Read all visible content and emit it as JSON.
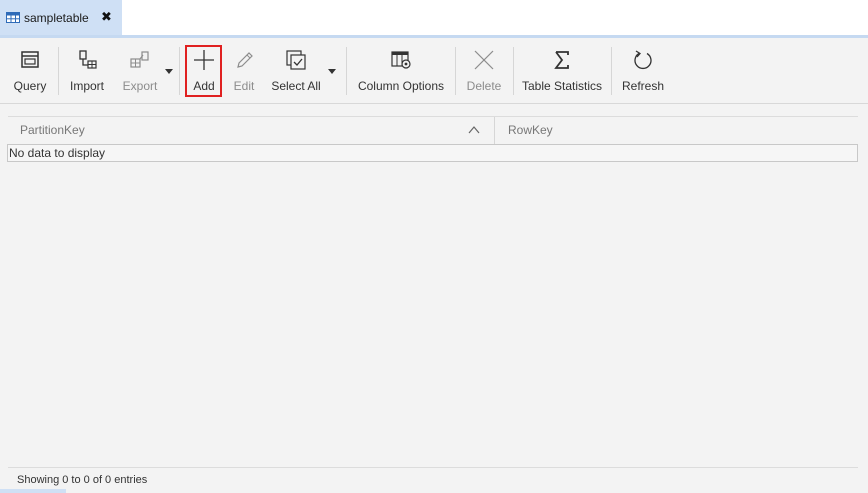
{
  "tab": {
    "label": "sampletable",
    "close": "✖"
  },
  "toolbar": {
    "query": "Query",
    "import": "Import",
    "export": "Export",
    "add": "Add",
    "edit": "Edit",
    "select_all": "Select All",
    "column_options": "Column Options",
    "delete": "Delete",
    "table_statistics": "Table Statistics",
    "refresh": "Refresh"
  },
  "grid": {
    "columns": [
      "PartitionKey",
      "RowKey"
    ],
    "empty_message": "No data to display"
  },
  "footer": {
    "status": "Showing 0 to 0 of 0 entries"
  },
  "colors": {
    "accent": "#cfe0f5",
    "highlight": "#e02020"
  }
}
